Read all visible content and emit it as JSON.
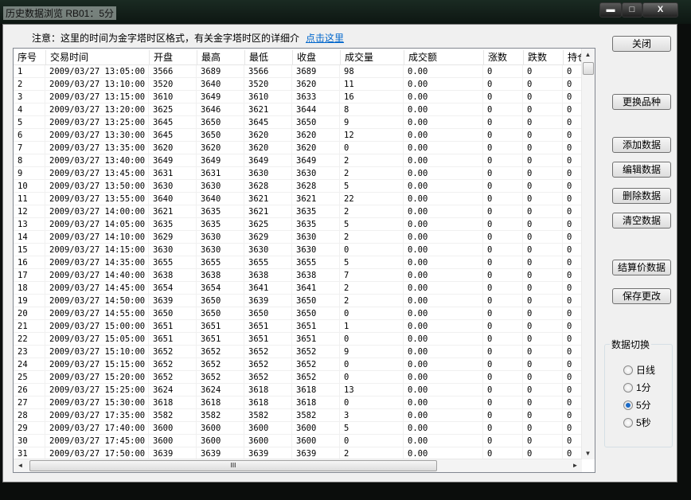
{
  "window": {
    "title": "历史数据浏览 RB01：5分",
    "minimize": "▬",
    "maximize": "□",
    "close": "X"
  },
  "notice": {
    "text": "注意：这里的时间为金字塔时区格式，有关金字塔时区的详细介",
    "link": "点击这里"
  },
  "table": {
    "columns": [
      "序号",
      "交易时间",
      "开盘",
      "最高",
      "最低",
      "收盘",
      "成交量",
      "成交额",
      "涨数",
      "跌数",
      "持仓"
    ],
    "rows": [
      [
        "1",
        "2009/03/27  13:05:00",
        "3566",
        "3689",
        "3566",
        "3689",
        "98",
        "0.00",
        "0",
        "0",
        "0"
      ],
      [
        "2",
        "2009/03/27  13:10:00",
        "3520",
        "3640",
        "3520",
        "3620",
        "11",
        "0.00",
        "0",
        "0",
        "0"
      ],
      [
        "3",
        "2009/03/27  13:15:00",
        "3610",
        "3649",
        "3610",
        "3633",
        "16",
        "0.00",
        "0",
        "0",
        "0"
      ],
      [
        "4",
        "2009/03/27  13:20:00",
        "3625",
        "3646",
        "3621",
        "3644",
        "8",
        "0.00",
        "0",
        "0",
        "0"
      ],
      [
        "5",
        "2009/03/27  13:25:00",
        "3645",
        "3650",
        "3645",
        "3650",
        "9",
        "0.00",
        "0",
        "0",
        "0"
      ],
      [
        "6",
        "2009/03/27  13:30:00",
        "3645",
        "3650",
        "3620",
        "3620",
        "12",
        "0.00",
        "0",
        "0",
        "0"
      ],
      [
        "7",
        "2009/03/27  13:35:00",
        "3620",
        "3620",
        "3620",
        "3620",
        "0",
        "0.00",
        "0",
        "0",
        "0"
      ],
      [
        "8",
        "2009/03/27  13:40:00",
        "3649",
        "3649",
        "3649",
        "3649",
        "2",
        "0.00",
        "0",
        "0",
        "0"
      ],
      [
        "9",
        "2009/03/27  13:45:00",
        "3631",
        "3631",
        "3630",
        "3630",
        "2",
        "0.00",
        "0",
        "0",
        "0"
      ],
      [
        "10",
        "2009/03/27  13:50:00",
        "3630",
        "3630",
        "3628",
        "3628",
        "5",
        "0.00",
        "0",
        "0",
        "0"
      ],
      [
        "11",
        "2009/03/27  13:55:00",
        "3640",
        "3640",
        "3621",
        "3621",
        "22",
        "0.00",
        "0",
        "0",
        "0"
      ],
      [
        "12",
        "2009/03/27  14:00:00",
        "3621",
        "3635",
        "3621",
        "3635",
        "2",
        "0.00",
        "0",
        "0",
        "0"
      ],
      [
        "13",
        "2009/03/27  14:05:00",
        "3635",
        "3635",
        "3625",
        "3635",
        "5",
        "0.00",
        "0",
        "0",
        "0"
      ],
      [
        "14",
        "2009/03/27  14:10:00",
        "3629",
        "3630",
        "3629",
        "3630",
        "2",
        "0.00",
        "0",
        "0",
        "0"
      ],
      [
        "15",
        "2009/03/27  14:15:00",
        "3630",
        "3630",
        "3630",
        "3630",
        "0",
        "0.00",
        "0",
        "0",
        "0"
      ],
      [
        "16",
        "2009/03/27  14:35:00",
        "3655",
        "3655",
        "3655",
        "3655",
        "5",
        "0.00",
        "0",
        "0",
        "0"
      ],
      [
        "17",
        "2009/03/27  14:40:00",
        "3638",
        "3638",
        "3638",
        "3638",
        "7",
        "0.00",
        "0",
        "0",
        "0"
      ],
      [
        "18",
        "2009/03/27  14:45:00",
        "3654",
        "3654",
        "3641",
        "3641",
        "2",
        "0.00",
        "0",
        "0",
        "0"
      ],
      [
        "19",
        "2009/03/27  14:50:00",
        "3639",
        "3650",
        "3639",
        "3650",
        "2",
        "0.00",
        "0",
        "0",
        "0"
      ],
      [
        "20",
        "2009/03/27  14:55:00",
        "3650",
        "3650",
        "3650",
        "3650",
        "0",
        "0.00",
        "0",
        "0",
        "0"
      ],
      [
        "21",
        "2009/03/27  15:00:00",
        "3651",
        "3651",
        "3651",
        "3651",
        "1",
        "0.00",
        "0",
        "0",
        "0"
      ],
      [
        "22",
        "2009/03/27  15:05:00",
        "3651",
        "3651",
        "3651",
        "3651",
        "0",
        "0.00",
        "0",
        "0",
        "0"
      ],
      [
        "23",
        "2009/03/27  15:10:00",
        "3652",
        "3652",
        "3652",
        "3652",
        "9",
        "0.00",
        "0",
        "0",
        "0"
      ],
      [
        "24",
        "2009/03/27  15:15:00",
        "3652",
        "3652",
        "3652",
        "3652",
        "0",
        "0.00",
        "0",
        "0",
        "0"
      ],
      [
        "25",
        "2009/03/27  15:20:00",
        "3652",
        "3652",
        "3652",
        "3652",
        "0",
        "0.00",
        "0",
        "0",
        "0"
      ],
      [
        "26",
        "2009/03/27  15:25:00",
        "3624",
        "3624",
        "3618",
        "3618",
        "13",
        "0.00",
        "0",
        "0",
        "0"
      ],
      [
        "27",
        "2009/03/27  15:30:00",
        "3618",
        "3618",
        "3618",
        "3618",
        "0",
        "0.00",
        "0",
        "0",
        "0"
      ],
      [
        "28",
        "2009/03/27  17:35:00",
        "3582",
        "3582",
        "3582",
        "3582",
        "3",
        "0.00",
        "0",
        "0",
        "0"
      ],
      [
        "29",
        "2009/03/27  17:40:00",
        "3600",
        "3600",
        "3600",
        "3600",
        "5",
        "0.00",
        "0",
        "0",
        "0"
      ],
      [
        "30",
        "2009/03/27  17:45:00",
        "3600",
        "3600",
        "3600",
        "3600",
        "0",
        "0.00",
        "0",
        "0",
        "0"
      ],
      [
        "31",
        "2009/03/27  17:50:00",
        "3639",
        "3639",
        "3639",
        "3639",
        "2",
        "0.00",
        "0",
        "0",
        "0"
      ]
    ]
  },
  "scroll": {
    "hgrip": "III",
    "up": "▲",
    "down": "▼",
    "left": "◄",
    "right": "►"
  },
  "buttons": {
    "close": "关闭",
    "change_symbol": "更换品种",
    "add": "添加数据",
    "edit": "编辑数据",
    "delete": "删除数据",
    "clear": "清空数据",
    "settlement": "结算价数据",
    "save": "保存更改"
  },
  "switch": {
    "label": "数据切换",
    "options": [
      {
        "label": "日线",
        "selected": false
      },
      {
        "label": "1分",
        "selected": false
      },
      {
        "label": "5分",
        "selected": true
      },
      {
        "label": "5秒",
        "selected": false
      }
    ]
  }
}
